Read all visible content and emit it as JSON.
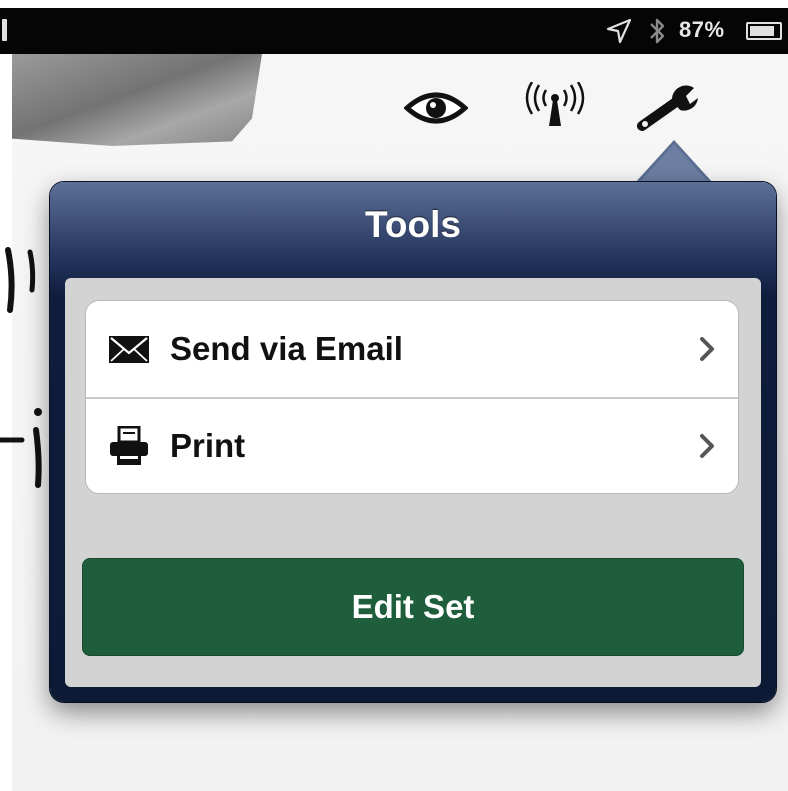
{
  "status_bar": {
    "battery_text": "87%",
    "battery_level": 0.87,
    "icons": [
      "signal-icon",
      "location-arrow-icon",
      "bluetooth-icon",
      "battery-icon"
    ]
  },
  "toolbar": {
    "icons": [
      "eye-icon",
      "antenna-icon",
      "wrench-icon"
    ]
  },
  "popover": {
    "title": "Tools",
    "items": [
      {
        "label": "Send via Email",
        "icon": "envelope-icon"
      },
      {
        "label": "Print",
        "icon": "printer-icon"
      }
    ],
    "action_button": {
      "label": "Edit Set"
    }
  },
  "colors": {
    "popover_header": "#1c2b50",
    "popover_body": "#d3d3d4",
    "action_button": "#1e5e3c"
  }
}
